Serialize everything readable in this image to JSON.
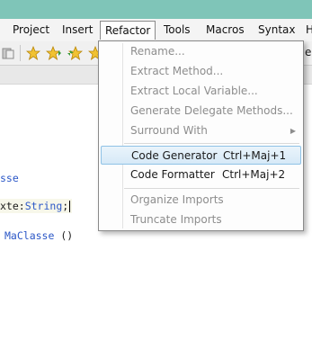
{
  "menubar": {
    "items": [
      "Project",
      "Insert",
      "Refactor",
      "Tools",
      "Macros",
      "Syntax",
      "H"
    ],
    "active": "Refactor"
  },
  "toolbar": {
    "icons": [
      "paste-icon",
      "star-icon",
      "star-forward-icon",
      "star-back-icon",
      "star-icon"
    ],
    "right_fragment": "el"
  },
  "editor": {
    "line1": "sse",
    "line2_prefix": "xte:",
    "line2_type": "String",
    "line2_suffix": ";",
    "line3_name": "MaClasse",
    "line3_suffix": "()"
  },
  "refactor_menu": {
    "items": [
      {
        "label": "Rename...",
        "shortcut": "",
        "enabled": false
      },
      {
        "label": "Extract Method...",
        "shortcut": "",
        "enabled": false
      },
      {
        "label": "Extract Local Variable...",
        "shortcut": "",
        "enabled": false
      },
      {
        "label": "Generate Delegate Methods...",
        "shortcut": "",
        "enabled": false
      },
      {
        "label": "Surround With",
        "shortcut": "",
        "enabled": false,
        "submenu": true
      },
      {
        "label": "Code Generator",
        "shortcut": "Ctrl+Maj+1",
        "enabled": true,
        "highlighted": true
      },
      {
        "label": "Code Formatter",
        "shortcut": "Ctrl+Maj+2",
        "enabled": true
      },
      {
        "label": "Organize Imports",
        "shortcut": "",
        "enabled": false
      },
      {
        "label": "Truncate Imports",
        "shortcut": "",
        "enabled": false
      }
    ]
  },
  "colors": {
    "titlebar": "#7fc5b8",
    "keyword": "#2b57c7",
    "highlight_border": "#8fc2e6"
  }
}
